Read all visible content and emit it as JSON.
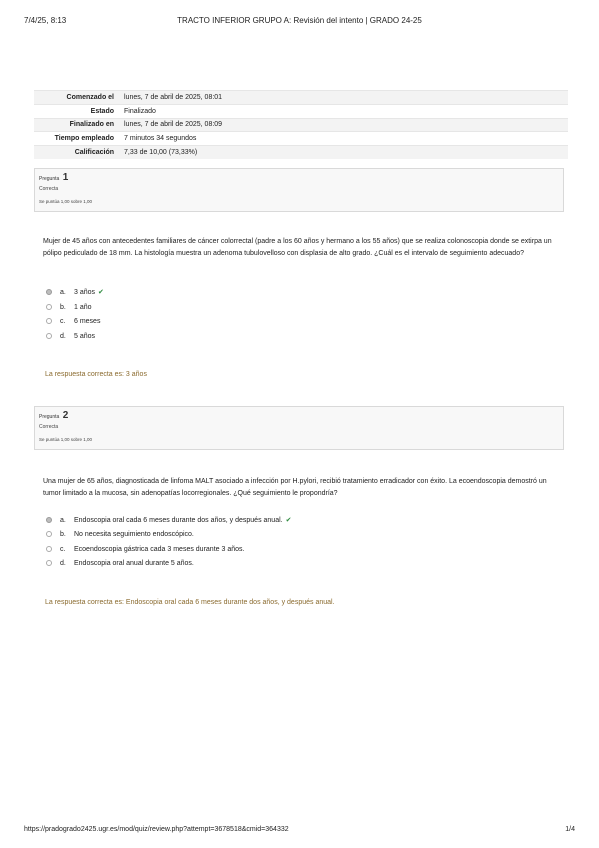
{
  "print_header": {
    "datetime": "7/4/25, 8:13",
    "title": "TRACTO INFERIOR GRUPO A: Revisión del intento | GRADO 24-25"
  },
  "summary": [
    {
      "label": "Comenzado el",
      "value": "lunes, 7 de abril de 2025, 08:01"
    },
    {
      "label": "Estado",
      "value": "Finalizado"
    },
    {
      "label": "Finalizado en",
      "value": "lunes, 7 de abril de 2025, 08:09"
    },
    {
      "label": "Tiempo empleado",
      "value": "7 minutos 34 segundos"
    },
    {
      "label": "Calificación",
      "value": "7,33 de 10,00 (73,33%)"
    }
  ],
  "questions": [
    {
      "label": "Pregunta",
      "number": "1",
      "state": "Correcta",
      "grade": "Se puntúa 1,00 sobre 1,00",
      "text": "Mujer de 45 años con antecedentes familiares de cáncer colorrectal (padre a los 60 años y hermano a los 55 años) que se realiza colonoscopia donde se extirpa un pólipo pediculado de 18 mm. La histología muestra un adenoma tubulovelloso con displasia de alto grado. ¿Cuál es el intervalo de seguimiento adecuado?",
      "options": [
        {
          "letter": "a.",
          "text": "3 años",
          "check": "✔"
        },
        {
          "letter": "b.",
          "text": "1 año",
          "check": ""
        },
        {
          "letter": "c.",
          "text": "6 meses",
          "check": ""
        },
        {
          "letter": "d.",
          "text": "5 años",
          "check": ""
        }
      ],
      "right_answer": "La respuesta correcta es: 3 años"
    },
    {
      "label": "Pregunta",
      "number": "2",
      "state": "Correcta",
      "grade": "Se puntúa 1,00 sobre 1,00",
      "text": "Una mujer de 65 años, diagnosticada de linfoma MALT asociado a infección por H.pylori, recibió tratamiento erradicador con éxito. La ecoendoscopia demostró un tumor limitado a la mucosa, sin adenopatías locorregionales. ¿Qué seguimiento le propondría?",
      "options": [
        {
          "letter": "a.",
          "text": "Endoscopia oral cada 6 meses durante dos años, y después anual.",
          "check": "✔"
        },
        {
          "letter": "b.",
          "text": "No necesita seguimiento endoscópico.",
          "check": ""
        },
        {
          "letter": "c.",
          "text": "Ecoendoscopia gástrica cada 3 meses durante 3 años.",
          "check": ""
        },
        {
          "letter": "d.",
          "text": "Endoscopia oral anual durante 5 años.",
          "check": ""
        }
      ],
      "right_answer": "La respuesta correcta es: Endoscopia oral cada 6 meses durante dos años, y después anual."
    }
  ],
  "print_footer": {
    "url": "https://pradogrado2425.ugr.es/mod/quiz/review.php?attempt=3678518&cmid=364332",
    "page": "1/4"
  }
}
